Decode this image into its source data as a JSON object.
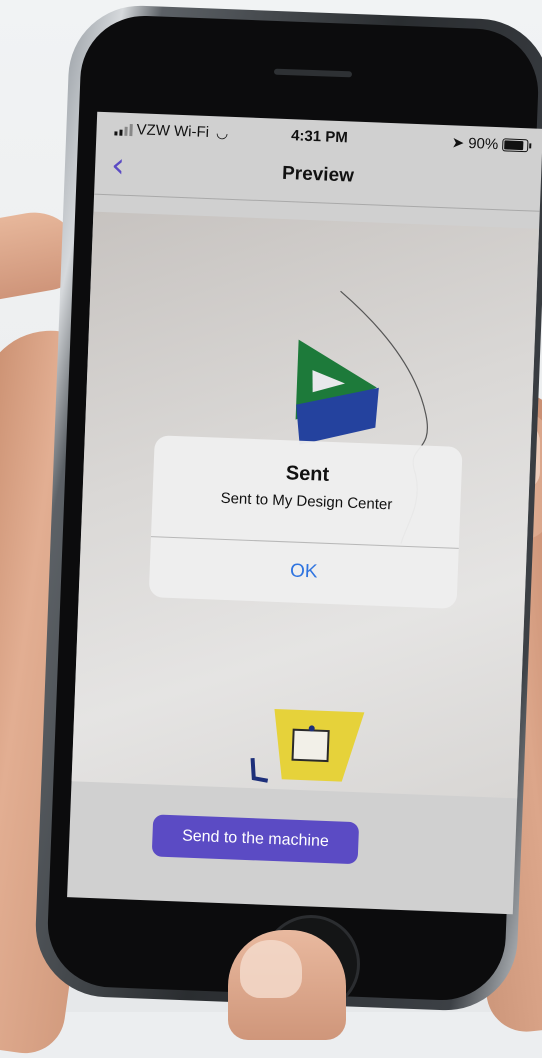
{
  "status_bar": {
    "carrier": "VZW Wi-Fi",
    "time": "4:31 PM",
    "battery": "90%",
    "location_icon": "location-arrow-icon",
    "wifi_icon": "wifi-icon"
  },
  "nav": {
    "back_icon": "chevron-left-icon",
    "back_glyph": "‹",
    "title": "Preview"
  },
  "alert": {
    "title": "Sent",
    "message": "Sent to My Design Center",
    "ok_label": "OK"
  },
  "footer": {
    "send_label": "Send to the machine"
  },
  "colors": {
    "accent": "#5b4bc4",
    "link": "#2f74e0",
    "screen_bg": "#d0d0d0"
  }
}
